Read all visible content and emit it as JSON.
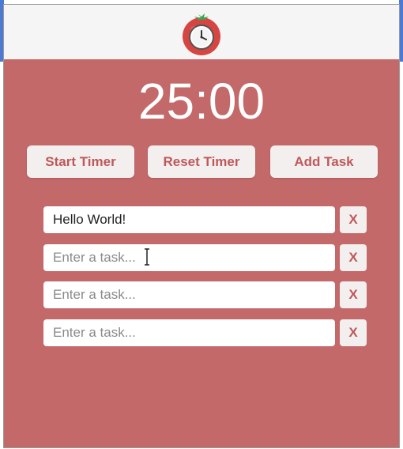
{
  "app": {
    "logo_icon": "tomato-clock-icon",
    "colors": {
      "background": "#c4696a",
      "header": "#f5f5f5",
      "button_bg": "#f3efef",
      "button_text": "#c0585a",
      "timer_text": "#ffffff"
    }
  },
  "timer": {
    "display": "25:00"
  },
  "controls": {
    "start_label": "Start Timer",
    "reset_label": "Reset Timer",
    "add_label": "Add Task"
  },
  "tasks": [
    {
      "value": "Hello World!",
      "placeholder": "Enter a task...",
      "delete_label": "X"
    },
    {
      "value": "",
      "placeholder": "Enter a task...",
      "delete_label": "X"
    },
    {
      "value": "",
      "placeholder": "Enter a task...",
      "delete_label": "X"
    },
    {
      "value": "",
      "placeholder": "Enter a task...",
      "delete_label": "X"
    }
  ]
}
